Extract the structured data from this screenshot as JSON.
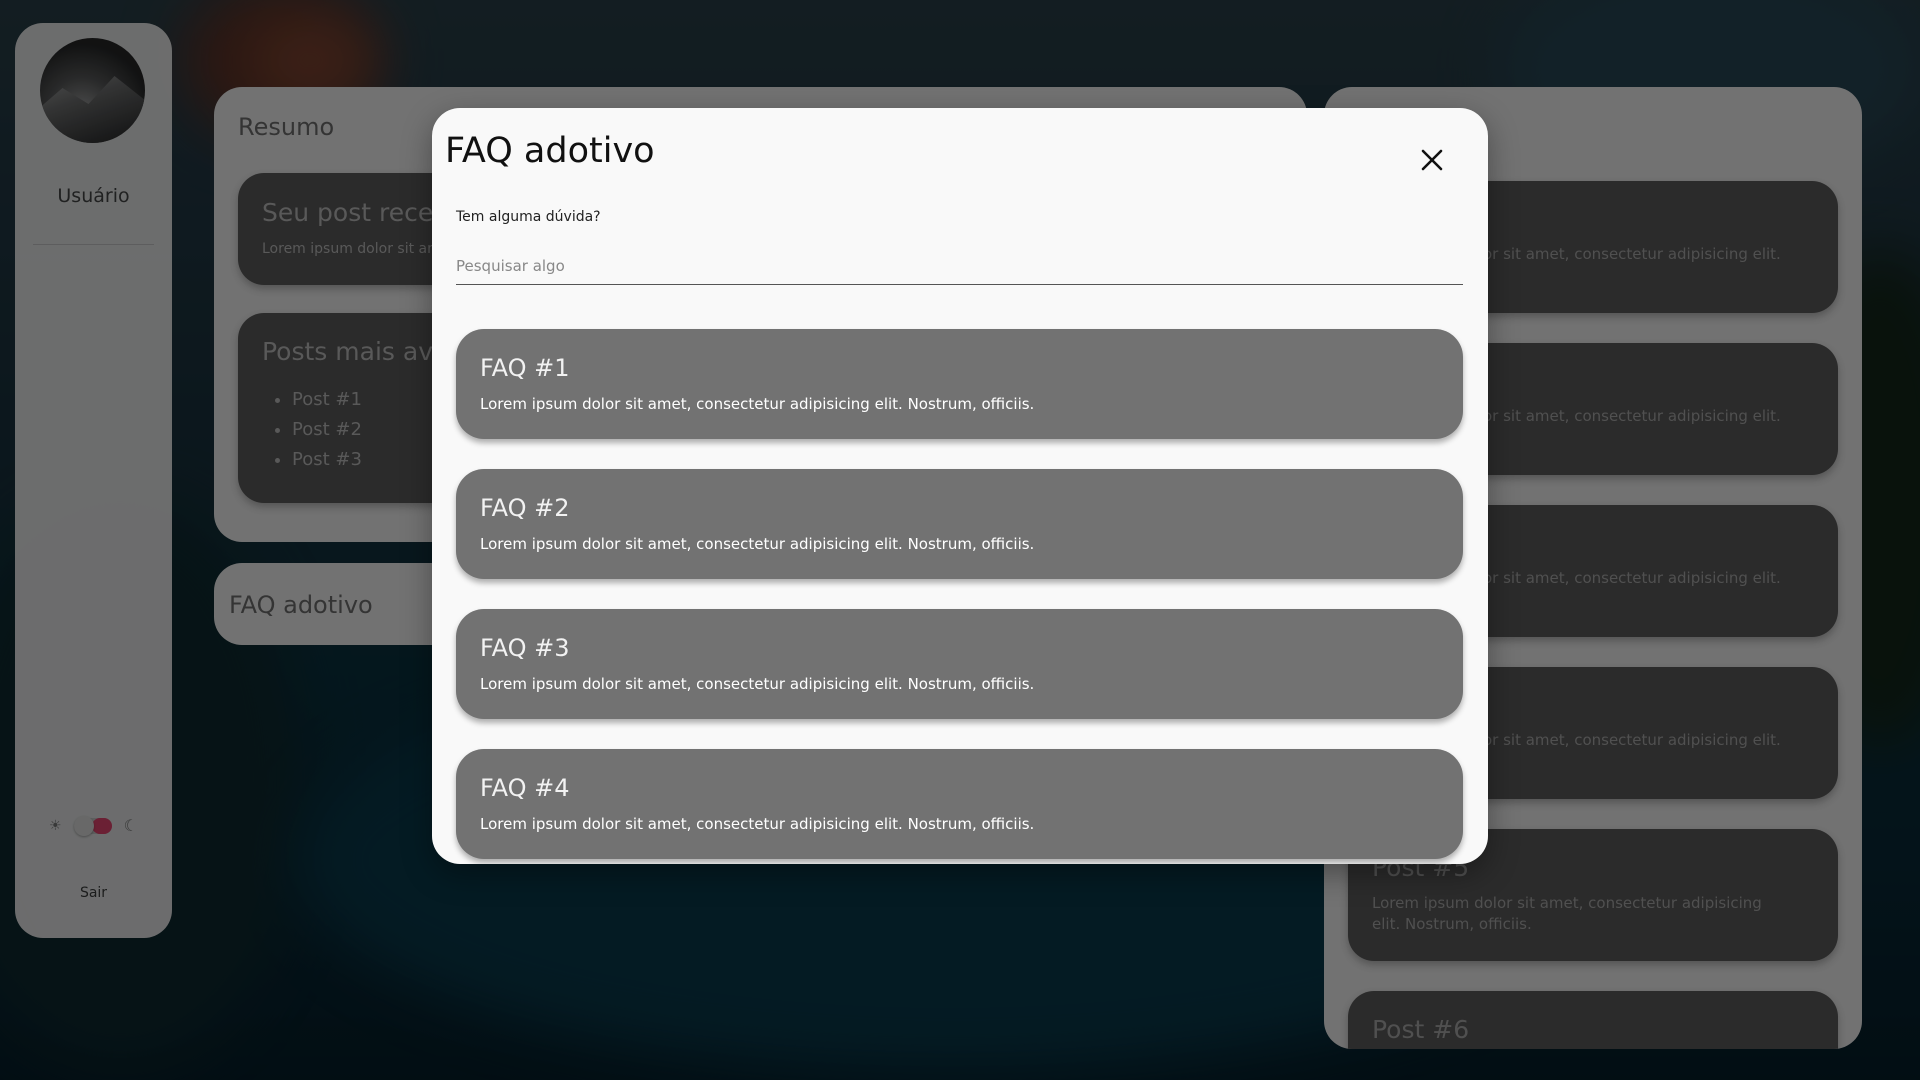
{
  "sidebar": {
    "user_label": "Usuário",
    "logout_label": "Sair",
    "theme": {
      "sun_icon": "☀",
      "moon_icon": "☾",
      "dark_mode": true,
      "accent": "#c23a5d"
    }
  },
  "summary": {
    "title": "Resumo",
    "card1": {
      "title": "Seu post recebe",
      "text": "Lorem ipsum dolor sit am"
    },
    "card2": {
      "title": "Posts mais avali",
      "items": [
        "Post #1",
        "Post #2",
        "Post #3"
      ]
    }
  },
  "faq_panel": {
    "title": "FAQ adotivo"
  },
  "posts": [
    {
      "text": "or sit amet, consectetur adipisicing elit."
    },
    {
      "text": "or sit amet, consectetur adipisicing elit."
    },
    {
      "text": "or sit amet, consectetur adipisicing elit."
    },
    {
      "text": "or sit amet, consectetur adipisicing elit."
    },
    {
      "title": "Post #5",
      "text": "Lorem ipsum dolor sit amet, consectetur adipisicing elit. Nostrum, officiis."
    },
    {
      "title": "Post #6"
    }
  ],
  "modal": {
    "title": "FAQ adotivo",
    "question_label": "Tem alguma dúvida?",
    "search": {
      "placeholder": "Pesquisar algo",
      "value": ""
    },
    "faqs": [
      {
        "title": "FAQ #1",
        "text": "Lorem ipsum dolor sit amet, consectetur adipisicing elit. Nostrum, officiis."
      },
      {
        "title": "FAQ #2",
        "text": "Lorem ipsum dolor sit amet, consectetur adipisicing elit. Nostrum, officiis."
      },
      {
        "title": "FAQ #3",
        "text": "Lorem ipsum dolor sit amet, consectetur adipisicing elit. Nostrum, officiis."
      },
      {
        "title": "FAQ #4",
        "text": "Lorem ipsum dolor sit amet, consectetur adipisicing elit. Nostrum, officiis."
      }
    ]
  }
}
